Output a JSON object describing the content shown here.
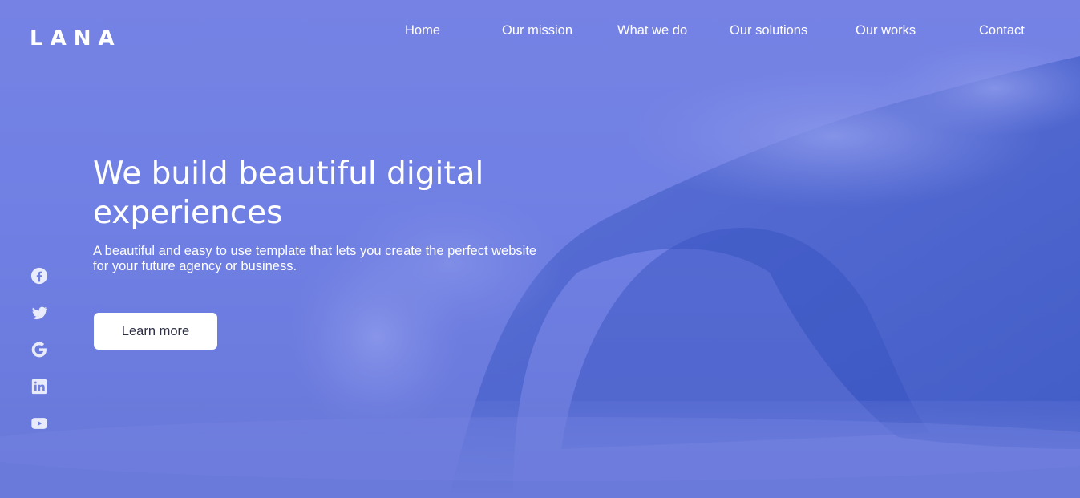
{
  "brand": {
    "logo": "LANA"
  },
  "nav": {
    "items": [
      {
        "label": "Home"
      },
      {
        "label": "Our mission"
      },
      {
        "label": "What we do"
      },
      {
        "label": "Our solutions"
      },
      {
        "label": "Our works"
      },
      {
        "label": "Contact"
      }
    ]
  },
  "hero": {
    "headline": "We build beautiful digital experiences",
    "subtext": "A beautiful and easy to use template that lets you create the perfect website for your future agency or business.",
    "cta_label": "Learn more"
  },
  "social": {
    "icons": [
      "facebook-icon",
      "twitter-icon",
      "google-icon",
      "linkedin-icon",
      "youtube-icon"
    ]
  },
  "colors": {
    "overlay": "#7683e5",
    "wave_dark": "#3f5cc4",
    "button_bg": "#ffffff",
    "button_text": "#2d2f45",
    "text": "#ffffff"
  }
}
